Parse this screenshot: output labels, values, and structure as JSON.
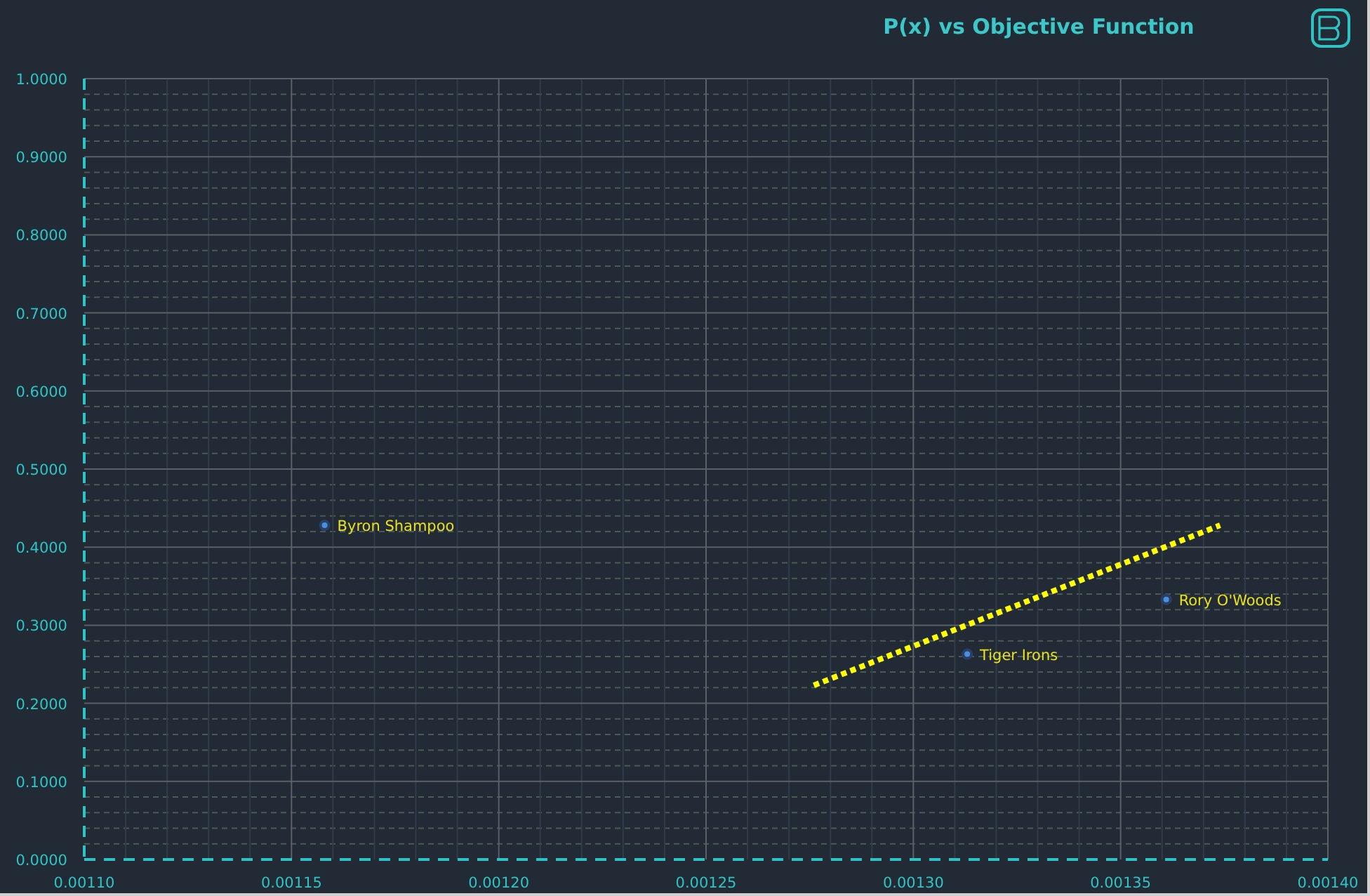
{
  "chart": {
    "chart_data": {
      "type": "scatter",
      "title": "P(x) vs Objective Function",
      "x": [
        0.001158,
        0.001313,
        0.001361
      ],
      "series": [
        {
          "color": "#4a8fe0",
          "values": [
            0.428,
            0.263,
            0.333
          ]
        },
        {
          "type": "line",
          "color": "#ffff00",
          "line_style": "dotted",
          "x": [
            0.001276,
            0.001374
          ],
          "values": [
            0.223,
            0.428
          ]
        }
      ],
      "xlim": [
        0.0011,
        0.0014
      ],
      "ylim": [
        0,
        1
      ],
      "grid": true,
      "xticks": [
        {
          "value": 0.0011,
          "label": "0.00110"
        },
        {
          "value": 0.00115,
          "label": "0.00115"
        },
        {
          "value": 0.0012,
          "label": "0.00120"
        },
        {
          "value": 0.00125,
          "label": "0.00125"
        },
        {
          "value": 0.0013,
          "label": "0.00130"
        },
        {
          "value": 0.00135,
          "label": "0.00135"
        },
        {
          "value": 0.0014,
          "label": "0.00140"
        }
      ],
      "yticks": [
        {
          "value": 0,
          "label": "0.0000"
        },
        {
          "value": 0.1,
          "label": "0.1000"
        },
        {
          "value": 0.2,
          "label": "0.2000"
        },
        {
          "value": 0.3,
          "label": "0.3000"
        },
        {
          "value": 0.4,
          "label": "0.4000"
        },
        {
          "value": 0.5,
          "label": "0.5000"
        },
        {
          "value": 0.6,
          "label": "0.6000"
        },
        {
          "value": 0.7,
          "label": "0.7000"
        },
        {
          "value": 0.8,
          "label": "0.8000"
        },
        {
          "value": 0.9,
          "label": "0.9000"
        },
        {
          "value": 1,
          "label": "1.0000"
        }
      ],
      "annotations": [
        {
          "text": "Byron Shampoo",
          "x": 0.001158,
          "y": 0.428
        },
        {
          "text": "Tiger Irons",
          "x": 0.001313,
          "y": 0.263
        },
        {
          "text": "Rory O'Woods",
          "x": 0.001361,
          "y": 0.333
        }
      ]
    }
  }
}
